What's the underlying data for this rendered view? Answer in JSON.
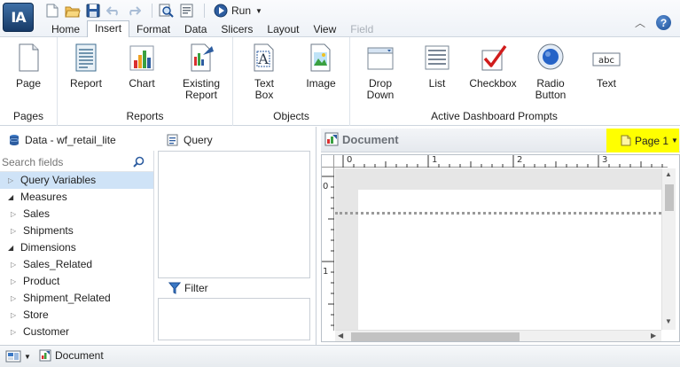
{
  "app": {
    "logo_text": "IA"
  },
  "quick_access": {
    "icons": [
      "new-document-icon",
      "open-folder-icon",
      "save-icon",
      "undo-icon",
      "redo-icon",
      "find-icon",
      "properties-icon"
    ],
    "run_label": "Run"
  },
  "tabs": [
    {
      "label": "Home",
      "state": "normal"
    },
    {
      "label": "Insert",
      "state": "active"
    },
    {
      "label": "Format",
      "state": "normal"
    },
    {
      "label": "Data",
      "state": "normal"
    },
    {
      "label": "Slicers",
      "state": "normal"
    },
    {
      "label": "Layout",
      "state": "normal"
    },
    {
      "label": "View",
      "state": "normal"
    },
    {
      "label": "Field",
      "state": "disabled"
    }
  ],
  "ribbon": {
    "groups": {
      "pages": {
        "label": "Pages",
        "buttons": [
          {
            "line1": "Page",
            "line2": ""
          }
        ]
      },
      "reports": {
        "label": "Reports",
        "buttons": [
          {
            "line1": "Report",
            "line2": ""
          },
          {
            "line1": "Chart",
            "line2": ""
          },
          {
            "line1": "Existing",
            "line2": "Report"
          }
        ]
      },
      "objects": {
        "label": "Objects",
        "buttons": [
          {
            "line1": "Text",
            "line2": "Box"
          },
          {
            "line1": "Image",
            "line2": ""
          }
        ]
      },
      "prompts": {
        "label": "Active Dashboard Prompts",
        "buttons": [
          {
            "line1": "Drop",
            "line2": "Down"
          },
          {
            "line1": "List",
            "line2": ""
          },
          {
            "line1": "Checkbox",
            "line2": ""
          },
          {
            "line1": "Radio",
            "line2": "Button"
          },
          {
            "line1": "Text",
            "line2": ""
          }
        ]
      }
    },
    "text_icon_glyph": "abc"
  },
  "data_panel": {
    "title": "Data - wf_retail_lite",
    "search_placeholder": "Search fields",
    "tree": [
      {
        "label": "Query Variables",
        "level": 0,
        "expanded": false,
        "selected": true
      },
      {
        "label": "Measures",
        "level": 0,
        "expanded": true,
        "selected": false
      },
      {
        "label": "Sales",
        "level": 1,
        "expanded": false,
        "selected": false
      },
      {
        "label": "Shipments",
        "level": 1,
        "expanded": false,
        "selected": false
      },
      {
        "label": "Dimensions",
        "level": 0,
        "expanded": true,
        "selected": false
      },
      {
        "label": "Sales_Related",
        "level": 1,
        "expanded": false,
        "selected": false
      },
      {
        "label": "Product",
        "level": 1,
        "expanded": false,
        "selected": false
      },
      {
        "label": "Shipment_Related",
        "level": 1,
        "expanded": false,
        "selected": false
      },
      {
        "label": "Store",
        "level": 1,
        "expanded": false,
        "selected": false
      },
      {
        "label": "Customer",
        "level": 1,
        "expanded": false,
        "selected": false
      }
    ]
  },
  "query_panel": {
    "title": "Query"
  },
  "filter_panel": {
    "title": "Filter"
  },
  "document": {
    "title": "Document",
    "page_selector": "Page 1",
    "ruler_h": [
      "0",
      "1",
      "2",
      "3"
    ],
    "ruler_v": [
      "0",
      "1"
    ]
  },
  "status": {
    "doc_label": "Document"
  },
  "colors": {
    "highlight": "#ffff00",
    "selection": "#cfe3f7",
    "accent": "#1d4f96"
  }
}
